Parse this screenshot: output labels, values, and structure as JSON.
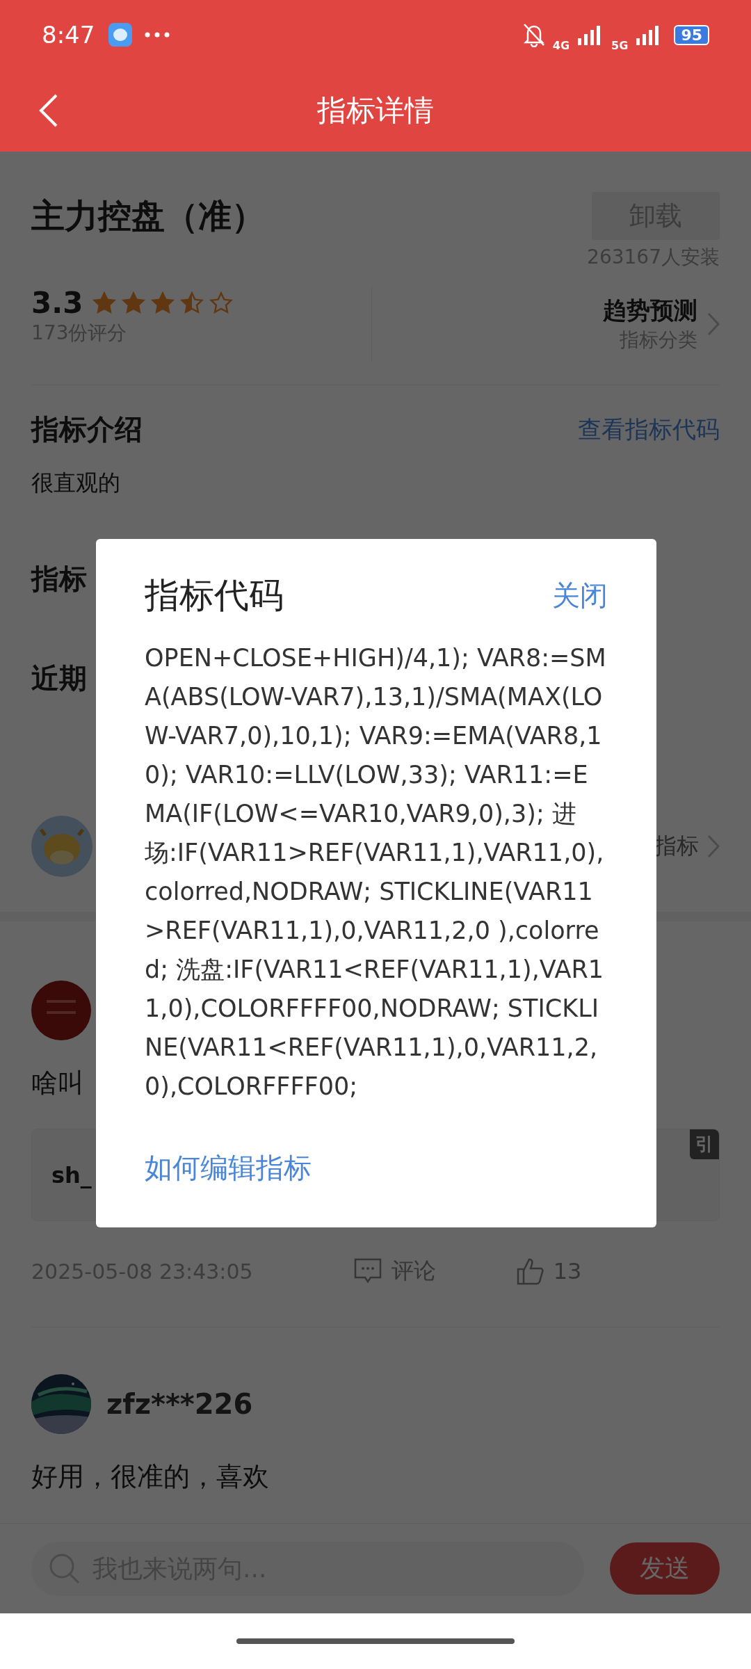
{
  "status_bar": {
    "time": "8:47",
    "network_1": "4G",
    "network_2": "5G",
    "battery": "95"
  },
  "header": {
    "title": "指标详情"
  },
  "indicator": {
    "name": "主力控盘（准）",
    "action": "卸载",
    "installs": "263167人安装",
    "rating": "3.3",
    "stars": 3.5,
    "rating_count": "173份评分",
    "category": "趋势预测",
    "category_label": "指标分类"
  },
  "intro": {
    "title": "指标介绍",
    "link": "查看指标代码",
    "text": "很直观的"
  },
  "sections": [
    "指标",
    "近期"
  ],
  "author_row": {
    "link": "指标"
  },
  "comments": [
    {
      "text": "啥叫",
      "quote": "sh_",
      "quote_tag": "引",
      "time": "2025-05-08 23:43:05",
      "reply_label": "评论",
      "likes": "13"
    },
    {
      "user": "zfz***226",
      "text": "好用，很准的，喜欢"
    }
  ],
  "composer": {
    "placeholder": "我也来说两句...",
    "send": "发送"
  },
  "dialog": {
    "title": "指标代码",
    "close": "关闭",
    "code": "OPEN+CLOSE+HIGH)/4,1); VAR8:=SMA(ABS(LOW-VAR7),13,1)/SMA(MAX(LOW-VAR7,0),10,1); VAR9:=EMA(VAR8,10); VAR10:=LLV(LOW,33); VAR11:=EMA(IF(LOW<=VAR10,VAR9,0),3); 进场:IF(VAR11>REF(VAR11,1),VAR11,0),colorred,NODRAW; STICKLINE(VAR11>REF(VAR11,1),0,VAR11,2,0 ),colorred; 洗盘:IF(VAR11<REF(VAR11,1),VAR11,0),COLORFFFF00,NODRAW; STICKLINE(VAR11<REF(VAR11,1),0,VAR11,2,0),COLORFFFF00;",
    "help_link": "如何编辑指标"
  }
}
